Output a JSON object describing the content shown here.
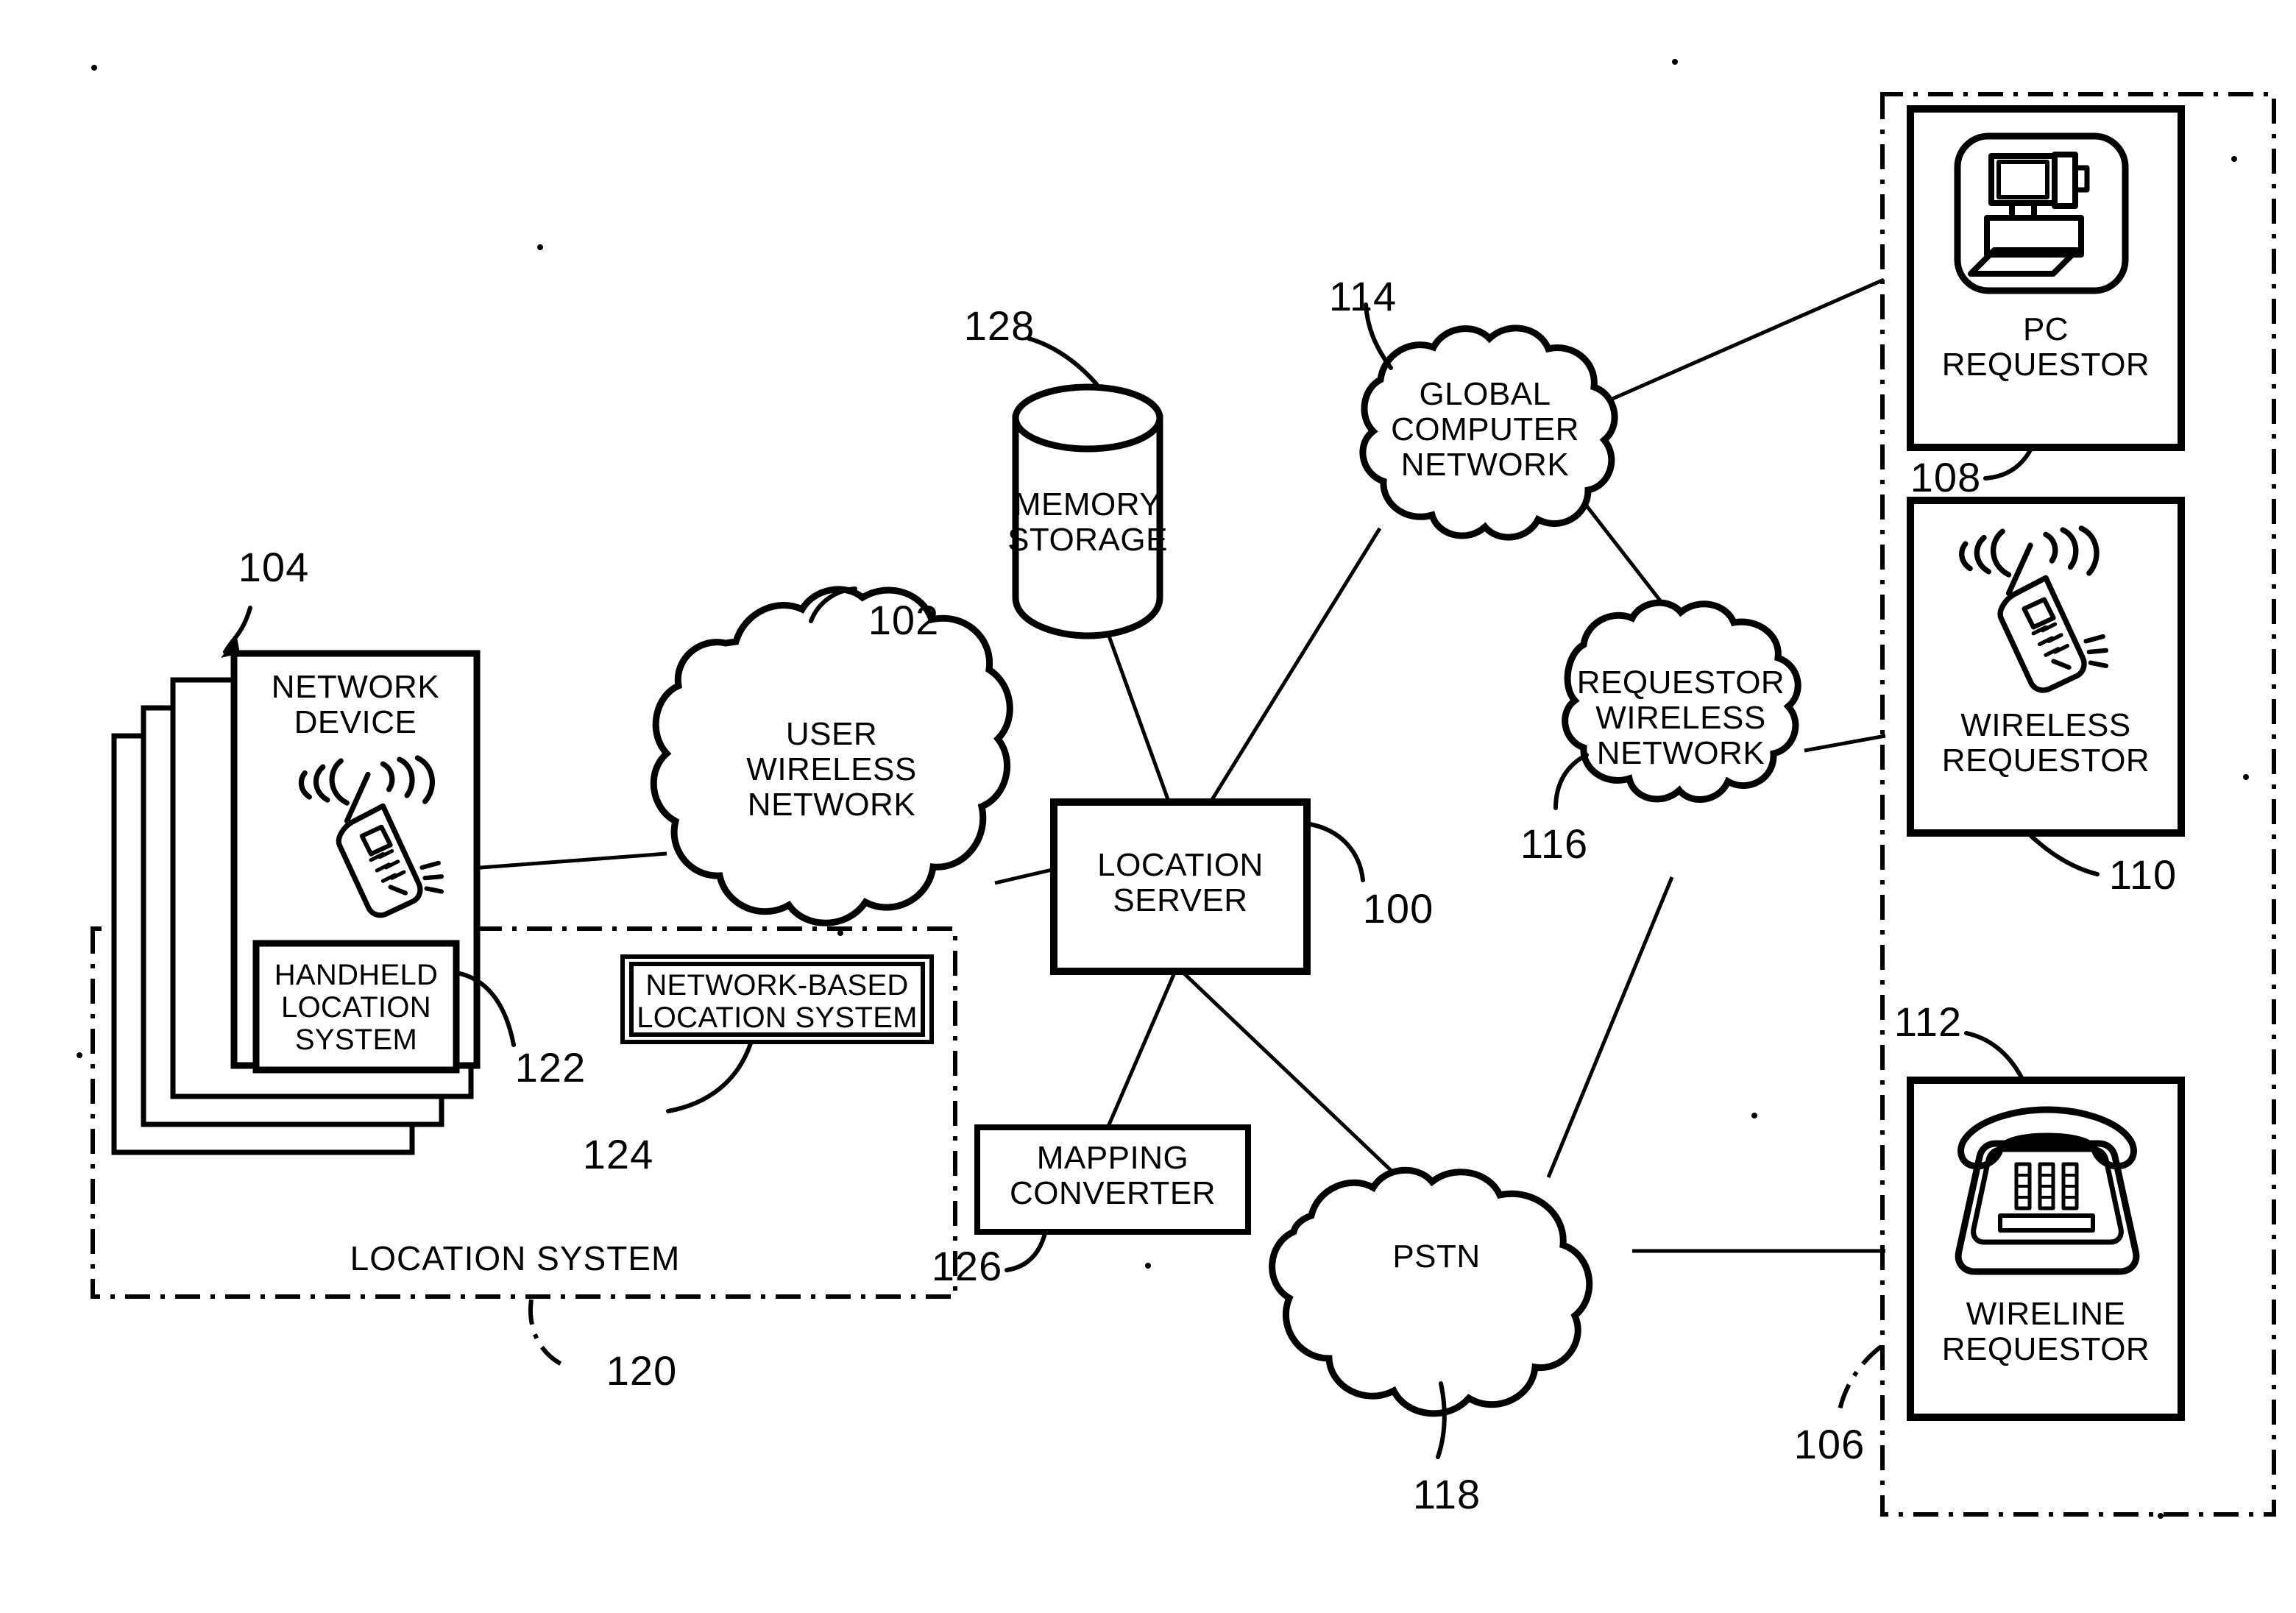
{
  "figure": {
    "type": "patent-block-diagram",
    "background": "#ffffff",
    "ink": "#000000"
  },
  "nodes": {
    "network_device": {
      "label_line1": "NETWORK",
      "label_line2": "DEVICE",
      "icon": "wireless-handset-icon",
      "ref": "104",
      "stack_count": 4
    },
    "handheld_location_system": {
      "label_line1": "HANDHELD",
      "label_line2": "LOCATION",
      "label_line3": "SYSTEM",
      "ref": "122"
    },
    "user_wireless_network": {
      "label_line1": "USER",
      "label_line2": "WIRELESS",
      "label_line3": "NETWORK",
      "ref": "102"
    },
    "network_based_location_system": {
      "label_line1": "NETWORK-BASED",
      "label_line2": "LOCATION SYSTEM",
      "ref": "124"
    },
    "memory_storage": {
      "label_line1": "MEMORY",
      "label_line2": "STORAGE",
      "ref": "128"
    },
    "location_server": {
      "label_line1": "LOCATION",
      "label_line2": "SERVER",
      "ref": "100"
    },
    "mapping_converter": {
      "label_line1": "MAPPING",
      "label_line2": "CONVERTER",
      "ref": "126"
    },
    "global_computer_network": {
      "label_line1": "GLOBAL",
      "label_line2": "COMPUTER",
      "label_line3": "NETWORK",
      "ref": "114"
    },
    "requestor_wireless_network": {
      "label_line1": "REQUESTOR",
      "label_line2": "WIRELESS",
      "label_line3": "NETWORK",
      "ref": "116"
    },
    "pstn": {
      "label_line1": "PSTN",
      "ref": "118"
    },
    "pc_requestor": {
      "label_line1": "PC",
      "label_line2": "REQUESTOR",
      "icon": "desktop-computer-icon",
      "ref": "108"
    },
    "wireless_requestor": {
      "label_line1": "WIRELESS",
      "label_line2": "REQUESTOR",
      "icon": "wireless-handset-icon",
      "ref": "110"
    },
    "wireline_requestor": {
      "label_line1": "WIRELINE",
      "label_line2": "REQUESTOR",
      "icon": "desk-telephone-icon",
      "ref": "112"
    }
  },
  "groups": {
    "location_system": {
      "label": "LOCATION SYSTEM",
      "ref": "120",
      "border": "dash-dot"
    },
    "requestor_group": {
      "ref": "106",
      "border": "dash-dot"
    }
  },
  "reference_numerals": [
    "100",
    "102",
    "104",
    "106",
    "108",
    "110",
    "112",
    "114",
    "116",
    "118",
    "120",
    "122",
    "124",
    "126",
    "128"
  ]
}
